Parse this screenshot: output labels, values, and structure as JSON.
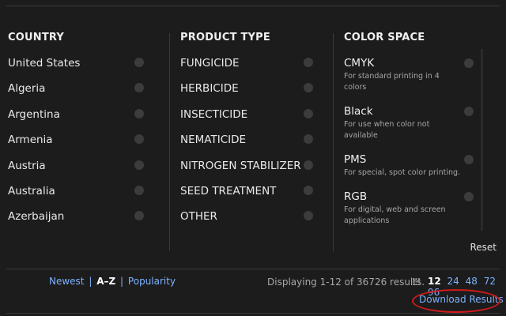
{
  "filters": {
    "country": {
      "header": "COUNTRY",
      "options": [
        "United States",
        "Algeria",
        "Argentina",
        "Armenia",
        "Austria",
        "Australia",
        "Azerbaijan"
      ]
    },
    "product_type": {
      "header": "PRODUCT TYPE",
      "options": [
        "FUNGICIDE",
        "HERBICIDE",
        "INSECTICIDE",
        "NEMATICIDE",
        "NITROGEN STABILIZER",
        "SEED TREATMENT",
        "OTHER"
      ]
    },
    "color_space": {
      "header": "COLOR SPACE",
      "options": [
        {
          "name": "CMYK",
          "desc": "For standard printing in 4 colors"
        },
        {
          "name": "Black",
          "desc": "For use when color not available"
        },
        {
          "name": "PMS",
          "desc": "For special, spot color printing."
        },
        {
          "name": "RGB",
          "desc": "For digital, web and screen applications"
        }
      ]
    },
    "reset_label": "Reset"
  },
  "sort": {
    "newest": "Newest",
    "az": "A–Z",
    "popularity": "Popularity",
    "separator": "|"
  },
  "results": {
    "display_text": "Displaying 1-12 of 36726 results.",
    "per_page": [
      "12",
      "24",
      "48",
      "72",
      "96"
    ],
    "current_per_page": "12"
  },
  "download_label": "Download Results",
  "colors": {
    "background": "#1c1c1c",
    "link": "#7fb2ff",
    "highlight_circle": "#d11a1a"
  }
}
